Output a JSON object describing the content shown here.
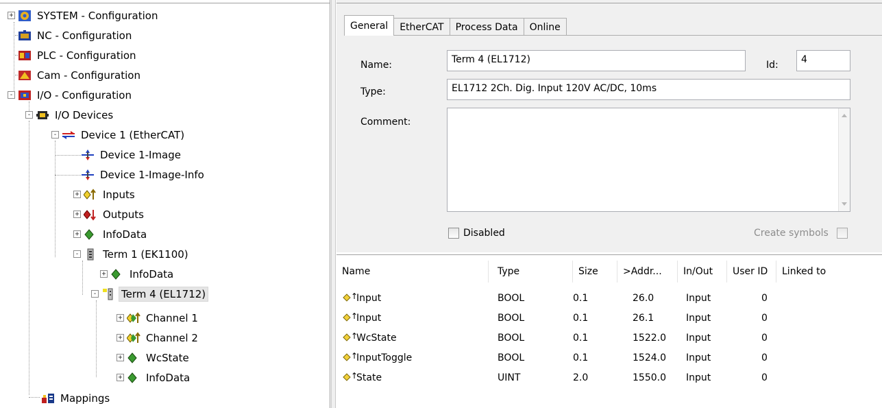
{
  "tree": {
    "items": [
      {
        "label": "SYSTEM - Configuration",
        "icon": "system-config-icon",
        "toggle": "+"
      },
      {
        "label": "NC - Configuration",
        "icon": "nc-config-icon",
        "toggle": ""
      },
      {
        "label": "PLC - Configuration",
        "icon": "plc-config-icon",
        "toggle": ""
      },
      {
        "label": "Cam - Configuration",
        "icon": "cam-config-icon",
        "toggle": ""
      },
      {
        "label": "I/O - Configuration",
        "icon": "io-config-icon",
        "toggle": "-"
      },
      {
        "label": "I/O Devices",
        "icon": "io-devices-icon",
        "toggle": "-"
      },
      {
        "label": "Device 1 (EtherCAT)",
        "icon": "ethercat-device-icon",
        "toggle": "-"
      },
      {
        "label": "Device 1-Image",
        "icon": "image-icon",
        "toggle": ""
      },
      {
        "label": "Device 1-Image-Info",
        "icon": "image-info-icon",
        "toggle": ""
      },
      {
        "label": "Inputs",
        "icon": "inputs-icon",
        "toggle": "+"
      },
      {
        "label": "Outputs",
        "icon": "outputs-icon",
        "toggle": "+"
      },
      {
        "label": "InfoData",
        "icon": "infodata-icon",
        "toggle": "+"
      },
      {
        "label": "Term 1 (EK1100)",
        "icon": "terminal-coupler-icon",
        "toggle": "-"
      },
      {
        "label": "InfoData",
        "icon": "infodata-icon",
        "toggle": "+"
      },
      {
        "label": "Term 4 (EL1712)",
        "icon": "terminal-icon",
        "toggle": "-"
      },
      {
        "label": "Channel 1",
        "icon": "channel-input-icon",
        "toggle": "+"
      },
      {
        "label": "Channel 2",
        "icon": "channel-input-icon",
        "toggle": "+"
      },
      {
        "label": "WcState",
        "icon": "wcstate-icon",
        "toggle": "+"
      },
      {
        "label": "InfoData",
        "icon": "infodata-icon",
        "toggle": "+"
      },
      {
        "label": "Mappings",
        "icon": "mappings-icon",
        "toggle": ""
      }
    ]
  },
  "tabs": [
    "General",
    "EtherCAT",
    "Process Data",
    "Online"
  ],
  "general": {
    "name_label": "Name:",
    "name_value": "Term 4 (EL1712)",
    "id_label": "Id:",
    "id_value": "4",
    "type_label": "Type:",
    "type_value": "EL1712 2Ch. Dig. Input 120V AC/DC, 10ms",
    "comment_label": "Comment:",
    "comment_value": "",
    "disabled_label": "Disabled",
    "create_symbols_label": "Create symbols"
  },
  "list": {
    "headers": [
      "Name",
      "Type",
      "Size",
      ">Addr...",
      "In/Out",
      "User ID",
      "Linked to"
    ],
    "rows": [
      {
        "name": "Input",
        "type": "BOOL",
        "size": "0.1",
        "addr": "26.0",
        "inout": "Input",
        "userid": "0"
      },
      {
        "name": "Input",
        "type": "BOOL",
        "size": "0.1",
        "addr": "26.1",
        "inout": "Input",
        "userid": "0"
      },
      {
        "name": "WcState",
        "type": "BOOL",
        "size": "0.1",
        "addr": "1522.0",
        "inout": "Input",
        "userid": "0"
      },
      {
        "name": "InputToggle",
        "type": "BOOL",
        "size": "0.1",
        "addr": "1524.0",
        "inout": "Input",
        "userid": "0"
      },
      {
        "name": "State",
        "type": "UINT",
        "size": "2.0",
        "addr": "1550.0",
        "inout": "Input",
        "userid": "0"
      }
    ]
  }
}
